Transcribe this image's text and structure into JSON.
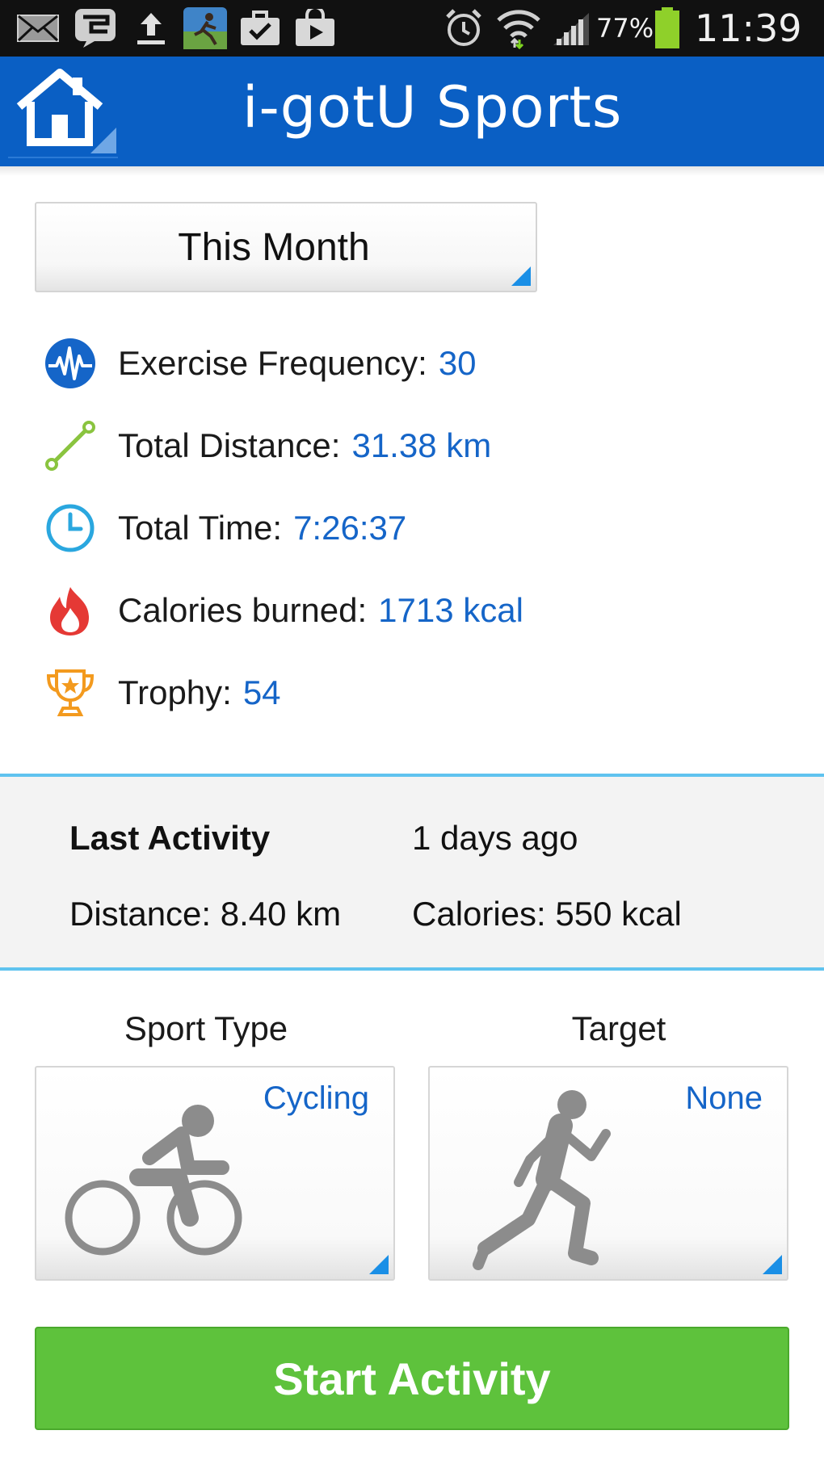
{
  "status_bar": {
    "battery": "77%",
    "time": "11:39",
    "icons": [
      "mail-icon",
      "chat-icon",
      "upload-icon",
      "app-thumbnail-icon",
      "briefcase-check-icon",
      "shopping-bag-icon",
      "alarm-icon",
      "wifi-icon",
      "signal-icon",
      "battery-icon"
    ]
  },
  "app_bar": {
    "title": "i-gotU Sports",
    "home_icon": "home-icon"
  },
  "period_selector": {
    "selected": "This Month"
  },
  "stats": [
    {
      "icon": "heartbeat-icon",
      "label": "Exercise Frequency:",
      "value": "30",
      "color": "#1565c8"
    },
    {
      "icon": "distance-icon",
      "label": "Total Distance:",
      "value": "31.38 km",
      "color": "#8ac43f"
    },
    {
      "icon": "clock-icon",
      "label": "Total Time:",
      "value": "7:26:37",
      "color": "#2aa7df"
    },
    {
      "icon": "flame-icon",
      "label": "Calories burned:",
      "value": "1713 kcal",
      "color": "#e53935"
    },
    {
      "icon": "trophy-icon",
      "label": "Trophy:",
      "value": "54",
      "color": "#f39a1e"
    }
  ],
  "last_activity": {
    "heading": "Last Activity",
    "when": "1 days ago",
    "distance": "Distance: 8.40 km",
    "calories": "Calories: 550 kcal"
  },
  "sport_type": {
    "caption": "Sport Type",
    "value": "Cycling",
    "icon": "cyclist-icon"
  },
  "target": {
    "caption": "Target",
    "value": "None",
    "icon": "runner-icon"
  },
  "start_button": {
    "label": "Start Activity"
  },
  "colors": {
    "app_bar": "#0a5fc4",
    "value_text": "#1565c8",
    "accent_line": "#5fc3ef",
    "start_button": "#5ec23c"
  }
}
